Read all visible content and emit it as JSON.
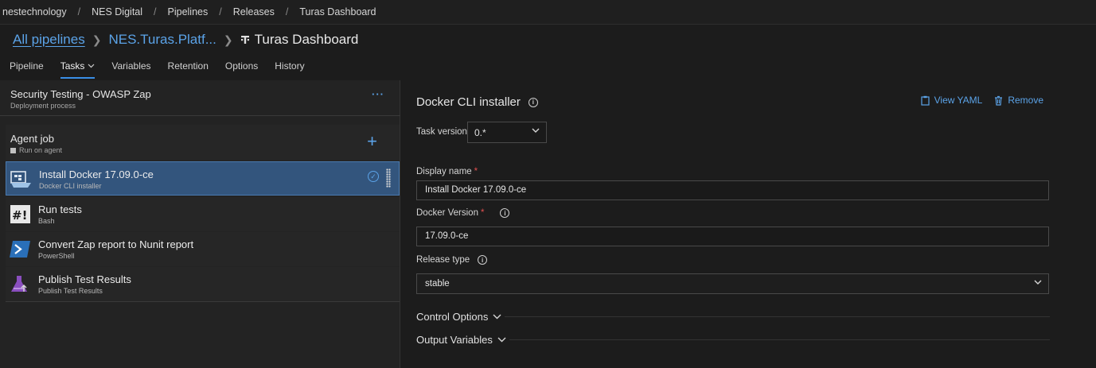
{
  "breadcrumb": [
    "nestechnology",
    "NES Digital",
    "Pipelines",
    "Releases",
    "Turas Dashboard"
  ],
  "title_row": {
    "all_pipelines": "All pipelines",
    "folder": "NES.Turas.Platf...",
    "page_title": "Turas Dashboard"
  },
  "tabs": [
    "Pipeline",
    "Tasks",
    "Variables",
    "Retention",
    "Options",
    "History"
  ],
  "active_tab": "Tasks",
  "stage": {
    "name": "Security Testing - OWASP Zap",
    "subtitle": "Deployment process",
    "more_label": "···"
  },
  "agent_job": {
    "name": "Agent job",
    "subtitle": "Run on agent",
    "add_label": "+"
  },
  "tasks": [
    {
      "name": "Install Docker 17.09.0-ce",
      "subtitle": "Docker CLI installer",
      "icon": "docker-icon",
      "selected": true
    },
    {
      "name": "Run tests",
      "subtitle": "Bash",
      "icon": "bash-icon",
      "selected": false
    },
    {
      "name": "Convert Zap report to Nunit report",
      "subtitle": "PowerShell",
      "icon": "powershell-icon",
      "selected": false
    },
    {
      "name": "Publish Test Results",
      "subtitle": "Publish Test Results",
      "icon": "publish-test-results-icon",
      "selected": false
    }
  ],
  "details": {
    "heading": "Docker CLI installer",
    "view_yaml": "View YAML",
    "remove": "Remove",
    "task_version_label": "Task version",
    "task_version_value": "0.*",
    "display_name_label": "Display name",
    "display_name_value": "Install Docker 17.09.0-ce",
    "docker_version_label": "Docker Version",
    "docker_version_value": "17.09.0-ce",
    "release_type_label": "Release type",
    "release_type_value": "stable",
    "required_mark": "*",
    "control_options": "Control Options",
    "output_variables": "Output Variables"
  },
  "colors": {
    "accent": "#5ba3e8",
    "selected_row": "#33557d",
    "required": "#e05050",
    "background": "#1c1c1c"
  }
}
